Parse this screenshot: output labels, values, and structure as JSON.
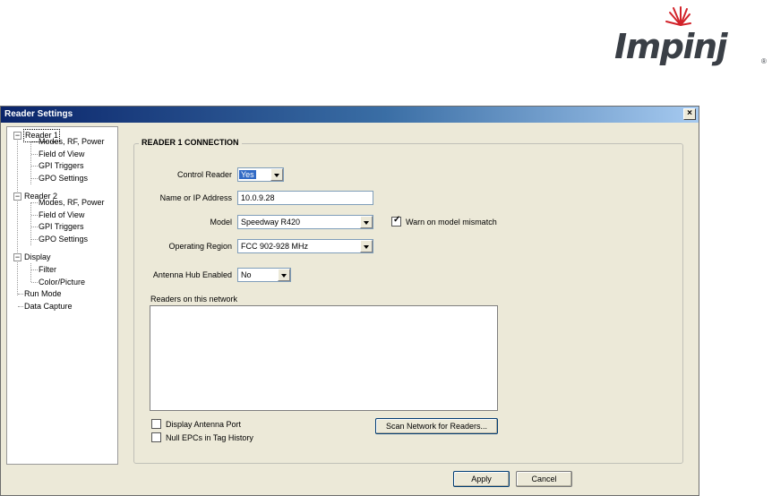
{
  "logo": {
    "text": "Impinj",
    "reg": "®"
  },
  "window": {
    "title": "Reader Settings",
    "close": "×"
  },
  "tree": {
    "items": [
      {
        "label": "Reader 1",
        "expander": "−"
      },
      {
        "label": "Modes, RF, Power"
      },
      {
        "label": "Field of View"
      },
      {
        "label": "GPI Triggers"
      },
      {
        "label": "GPO Settings"
      },
      {
        "label": "Reader 2",
        "expander": "−"
      },
      {
        "label": "Modes, RF, Power"
      },
      {
        "label": "Field of View"
      },
      {
        "label": "GPI Triggers"
      },
      {
        "label": "GPO Settings"
      },
      {
        "label": "Display",
        "expander": "−"
      },
      {
        "label": "Filter"
      },
      {
        "label": "Color/Picture"
      },
      {
        "label": "Run Mode"
      },
      {
        "label": "Data Capture"
      }
    ]
  },
  "connection": {
    "group_title": "READER 1 CONNECTION",
    "control_reader": {
      "label": "Control Reader",
      "value": "Yes"
    },
    "name_ip": {
      "label": "Name or IP Address",
      "value": "10.0.9.28"
    },
    "model": {
      "label": "Model",
      "value": "Speedway R420"
    },
    "warn_mismatch": {
      "label": "Warn on model mismatch",
      "checked": true
    },
    "region": {
      "label": "Operating Region",
      "value": "FCC 902-928 MHz"
    },
    "hub": {
      "label": "Antenna Hub Enabled",
      "value": "No"
    },
    "readers_label": "Readers on this network",
    "display_antenna": {
      "label": "Display Antenna Port",
      "checked": false
    },
    "null_epcs": {
      "label": "Null EPCs in Tag History",
      "checked": false
    },
    "scan_button": "Scan Network for Readers..."
  },
  "footer": {
    "apply": "Apply",
    "cancel": "Cancel"
  },
  "colors": {
    "titlebar": "#0a246a",
    "selection": "#316ac5",
    "face": "#ece9d8",
    "logo_star": "#d2232a"
  }
}
